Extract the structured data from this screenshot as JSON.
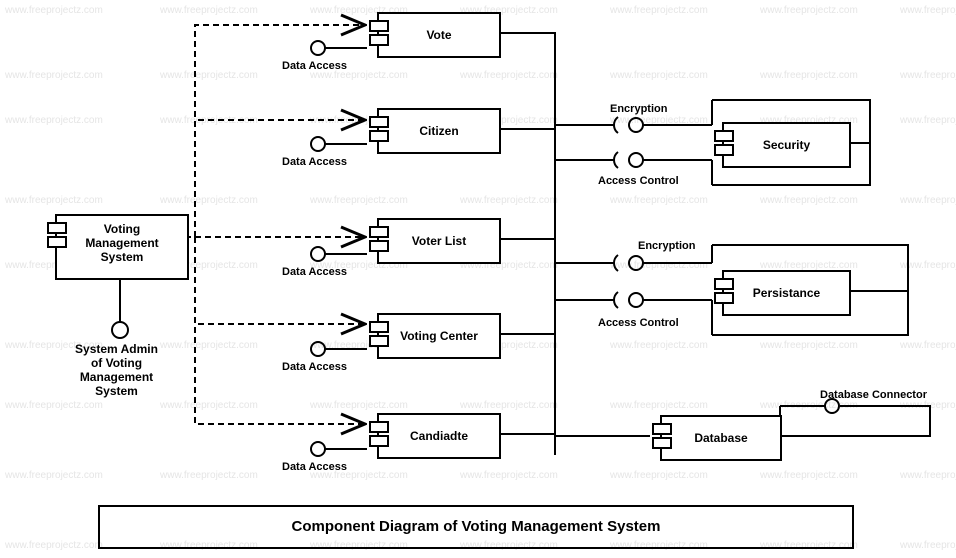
{
  "diagram_title": "Component Diagram of Voting Management System",
  "main_component": {
    "name": "Voting\nManagement\nSystem"
  },
  "admin_label": "System Admin\nof Voting\nManagement\nSystem",
  "middle_components": [
    {
      "name": "Vote",
      "data_access": "Data Access"
    },
    {
      "name": "Citizen",
      "data_access": "Data Access"
    },
    {
      "name": "Voter List",
      "data_access": "Data Access"
    },
    {
      "name": "Voting Center",
      "data_access": "Data Access"
    },
    {
      "name": "Candiadte",
      "data_access": "Data Access"
    }
  ],
  "right_components": [
    {
      "name": "Security",
      "encryption": "Encryption",
      "access_control": "Access Control"
    },
    {
      "name": "Persistance",
      "encryption": "Encryption",
      "access_control": "Access Control"
    },
    {
      "name": "Database"
    },
    {
      "name": "Database Connector"
    }
  ],
  "watermark_text": "www.freeprojectz.com",
  "chart_data": {
    "type": "component-diagram",
    "title": "Component Diagram of Voting Management System",
    "components": [
      "Voting Management System",
      "Vote",
      "Citizen",
      "Voter List",
      "Voting Center",
      "Candiadte",
      "Security",
      "Persistance",
      "Database",
      "Database Connector"
    ],
    "interfaces": [
      {
        "name": "System Admin of Voting Management System",
        "provided_by": "Voting Management System"
      },
      {
        "name": "Data Access",
        "provided_by": "Vote"
      },
      {
        "name": "Data Access",
        "provided_by": "Citizen"
      },
      {
        "name": "Data Access",
        "provided_by": "Voter List"
      },
      {
        "name": "Data Access",
        "provided_by": "Voting Center"
      },
      {
        "name": "Data Access",
        "provided_by": "Candiadte"
      },
      {
        "name": "Encryption",
        "required_by": "Security"
      },
      {
        "name": "Access Control",
        "required_by": "Security"
      },
      {
        "name": "Encryption",
        "required_by": "Persistance"
      },
      {
        "name": "Access Control",
        "required_by": "Persistance"
      },
      {
        "name": "Database Connector",
        "between": [
          "Database",
          "Database Connector"
        ]
      }
    ],
    "dependencies": [
      {
        "from": "Voting Management System",
        "to": "Vote"
      },
      {
        "from": "Voting Management System",
        "to": "Citizen"
      },
      {
        "from": "Voting Management System",
        "to": "Voter List"
      },
      {
        "from": "Voting Management System",
        "to": "Voting Center"
      },
      {
        "from": "Voting Management System",
        "to": "Candiadte"
      }
    ]
  }
}
